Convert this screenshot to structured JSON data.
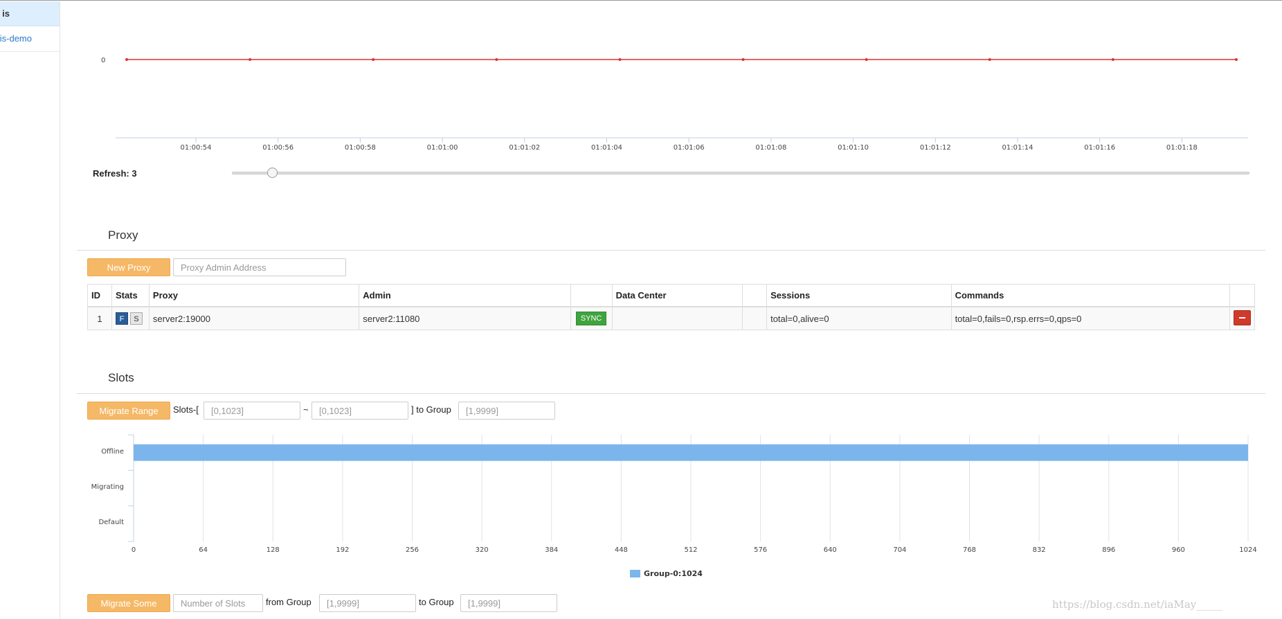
{
  "sidebar": {
    "header": "is",
    "items": [
      {
        "label": "is-demo"
      }
    ]
  },
  "ops_chart": {
    "y_label": "0",
    "x_ticks": [
      "01:00:54",
      "01:00:56",
      "01:00:58",
      "01:01:00",
      "01:01:02",
      "01:01:04",
      "01:01:06",
      "01:01:08",
      "01:01:10",
      "01:01:12",
      "01:01:14",
      "01:01:16",
      "01:01:18"
    ],
    "line_color": "#e03030"
  },
  "refresh": {
    "label": "Refresh: 3",
    "value": 3
  },
  "proxy": {
    "title": "Proxy",
    "new_button": "New Proxy",
    "address_placeholder": "Proxy Admin Address",
    "columns": [
      "ID",
      "Stats",
      "Proxy",
      "Admin",
      "",
      "Data Center",
      "",
      "Sessions",
      "Commands",
      ""
    ],
    "rows": [
      {
        "id": "1",
        "f": "F",
        "s": "S",
        "proxy": "server2:19000",
        "admin": "server2:11080",
        "sync": "SYNC",
        "data_center": "",
        "sessions": "total=0,alive=0",
        "commands": "total=0,fails=0,rsp.errs=0,qps=0"
      }
    ]
  },
  "slots": {
    "title": "Slots",
    "migrate_range_button": "Migrate Range",
    "slots_prefix": "Slots-[",
    "range_from_placeholder": "[0,1023]",
    "tilde": "~",
    "range_to_placeholder": "[0,1023]",
    "to_group_text": "] to Group",
    "group_placeholder": "[1,9999]",
    "migrate_some_button": "Migrate Some",
    "number_placeholder": "Number of Slots",
    "from_group_text": "from Group",
    "from_group_placeholder": "[1,9999]",
    "to_group_text2": "to Group",
    "to_group_placeholder": "[1,9999]"
  },
  "chart_data": {
    "type": "bar",
    "orientation": "horizontal",
    "categories": [
      "Offline",
      "Migrating",
      "Default"
    ],
    "series": [
      {
        "name": "Group-0:1024",
        "values": [
          1024,
          0,
          0
        ],
        "color": "#7cb5ec"
      }
    ],
    "x_ticks": [
      "0",
      "64",
      "128",
      "192",
      "256",
      "320",
      "384",
      "448",
      "512",
      "576",
      "640",
      "704",
      "768",
      "832",
      "896",
      "960",
      "1024"
    ],
    "xlim": [
      0,
      1024
    ],
    "grid": true,
    "legend_placement": "bottom-center"
  },
  "watermark": "https://blog.csdn.net/iaMay_____"
}
